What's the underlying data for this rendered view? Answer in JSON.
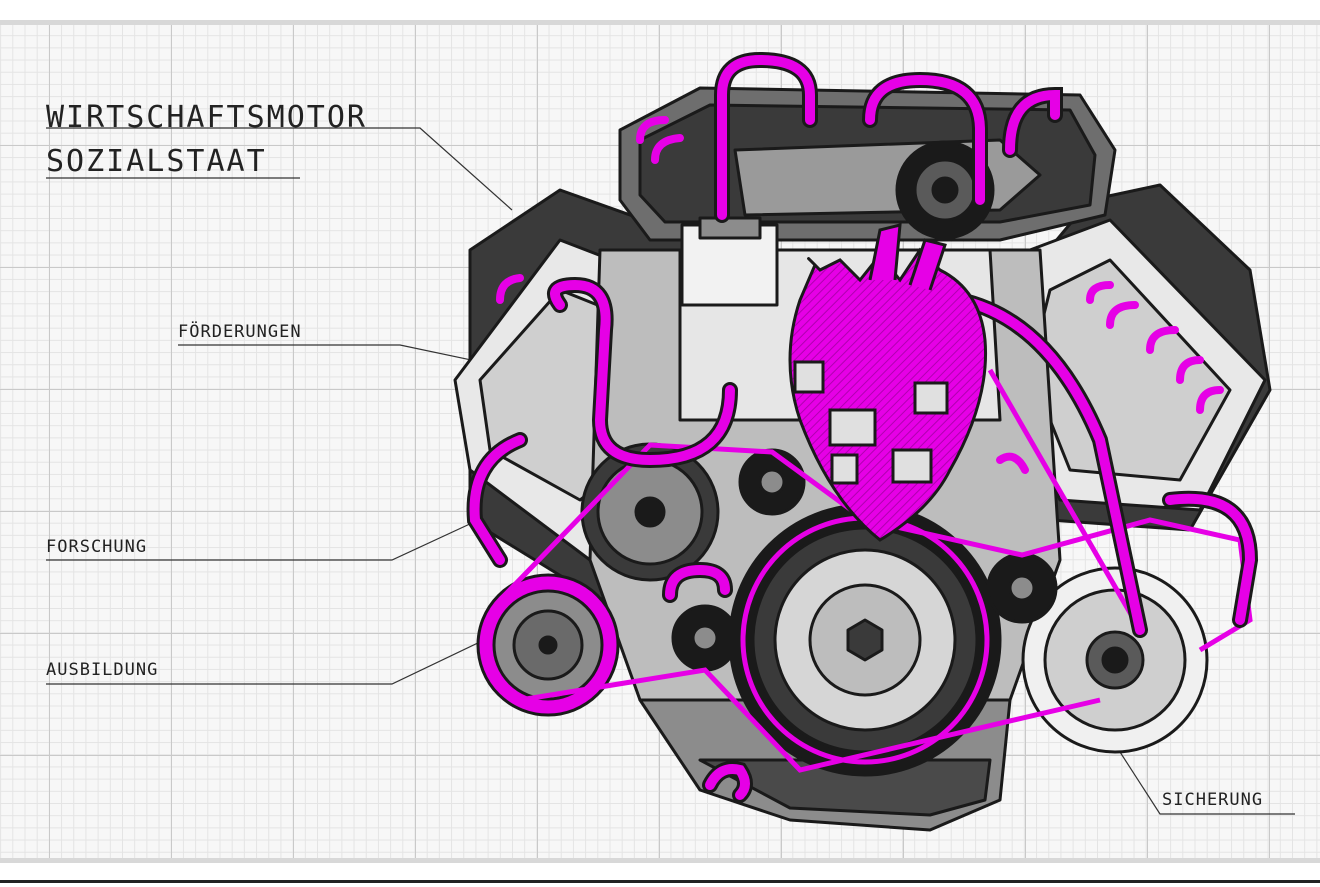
{
  "title": {
    "line1": "WIRTSCHAFTSMOTOR",
    "line2": "SOZIALSTAAT"
  },
  "labels": {
    "foerderungen": "FÖRDERUNGEN",
    "forschung": "FORSCHUNG",
    "ausbildung": "AUSBILDUNG",
    "sicherung": "SICHERUNG"
  },
  "colors": {
    "accent": "#e600e6",
    "ink": "#1a1a1a",
    "metal_dark": "#3a3a3a",
    "metal_mid": "#8c8c8c",
    "metal_light": "#d6d6d6",
    "grid": "#c9c9c9"
  }
}
